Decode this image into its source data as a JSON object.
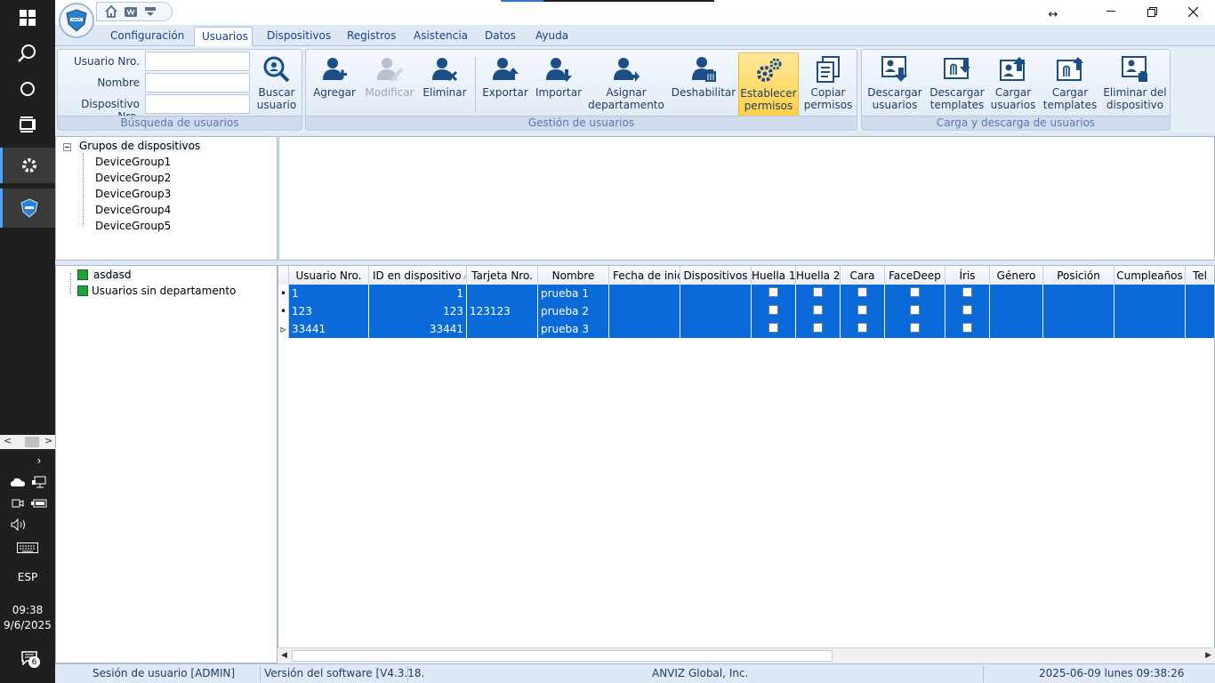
{
  "taskbar": {
    "language": "ESP",
    "time": "09:38",
    "date": "9/6/2025",
    "notification_count": "6"
  },
  "menu": {
    "tabs": [
      "Configuración",
      "Usuarios",
      "Dispositivos",
      "Registros",
      "Asistencia",
      "Datos",
      "Ayuda"
    ],
    "active_tab": "Usuarios"
  },
  "search": {
    "label_user_no": "Usuario Nro.",
    "label_name": "Nombre",
    "label_device_no": "Dispositivo Nro.",
    "user_no_value": "",
    "name_value": "",
    "device_no_value": "",
    "search_button": "Buscar\nusuario",
    "group_title": "Búsqueda de usuarios"
  },
  "management": {
    "group_title": "Gestión de usuarios",
    "add": "Agregar",
    "modify": "Modificar",
    "delete": "Eliminar",
    "export": "Exportar",
    "import": "Importar",
    "assign_dept": "Asignar\ndepartamento",
    "disable": "Deshabilitar",
    "set_perms": "Establecer\npermisos",
    "copy_perms": "Copiar\npermisos"
  },
  "transfer": {
    "group_title": "Carga y descarga de usuarios",
    "download_users": "Descargar\nusuarios",
    "download_templates": "Descargar\ntemplates",
    "upload_users": "Cargar\nusuarios",
    "upload_templates": "Cargar\ntemplates",
    "delete_from_device": "Eliminar del\ndispositivo"
  },
  "device_tree": {
    "root": "Grupos de dispositivos",
    "children": [
      "DeviceGroup1",
      "DeviceGroup2",
      "DeviceGroup3",
      "DeviceGroup4",
      "DeviceGroup5"
    ]
  },
  "dept_tree": {
    "items": [
      "asdasd",
      "Usuarios sin departamento"
    ]
  },
  "grid": {
    "columns": [
      "Usuario Nro.",
      "ID en dispositivo",
      "Tarjeta Nro.",
      "Nombre",
      "Fecha de inicio",
      "Dispositivos",
      "Huella 1",
      "Huella 2",
      "Cara",
      "FaceDeep",
      "Íris",
      "Género",
      "Posición",
      "Cumpleaños",
      "Tel"
    ],
    "sort_indicator": "⁄",
    "rows": [
      {
        "user_no": "1",
        "device_id": "1",
        "card": "",
        "name": "prueba 1"
      },
      {
        "user_no": "123",
        "device_id": "123",
        "card": "123123",
        "name": "prueba 2"
      },
      {
        "user_no": "33441",
        "device_id": "33441",
        "card": "",
        "name": "prueba 3"
      }
    ]
  },
  "status": {
    "session": "Sesión de usuario  [ADMIN]",
    "version": "Versión del software  [V4.3.18.",
    "company": "ANVIZ Global, Inc.",
    "datetime": "2025-06-09 lunes 09:38:26"
  },
  "colors": {
    "selection": "#0a6ad8",
    "accent": "#15428b",
    "highlight": "#ffd14a"
  }
}
